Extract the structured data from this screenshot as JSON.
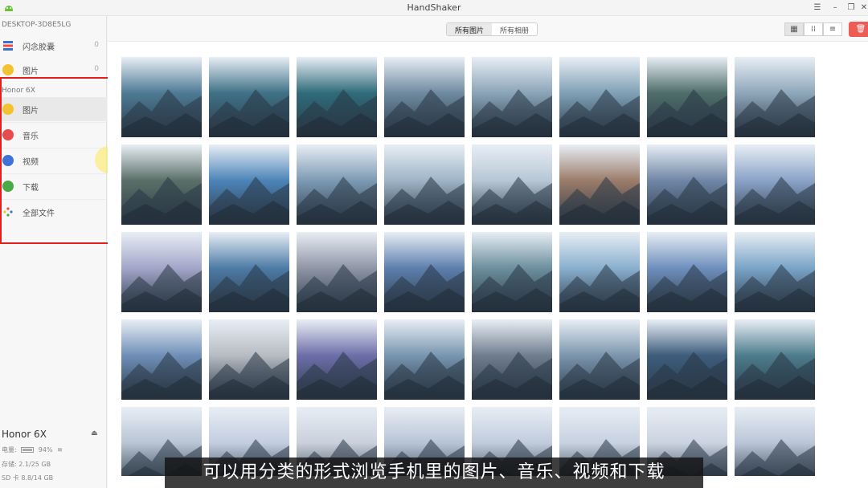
{
  "window": {
    "title": "HandShaker"
  },
  "sidebar": {
    "computer_name": "DESKTOP-3D8E5LG",
    "computer_items": [
      {
        "label": "闪念胶囊",
        "count": "0",
        "color": "#3b6fd0",
        "icon": "capsule-icon"
      },
      {
        "label": "图片",
        "count": "0",
        "color": "#f2c230",
        "icon": "photo-icon"
      }
    ],
    "device_header": "Honor 6X",
    "device_items": [
      {
        "label": "图片",
        "color": "#f2c230",
        "icon": "photo-icon"
      },
      {
        "label": "音乐",
        "color": "#e84b4b",
        "icon": "music-icon"
      },
      {
        "label": "视频",
        "color": "#3e72d8",
        "icon": "video-icon"
      },
      {
        "label": "下载",
        "color": "#49a947",
        "icon": "download-icon"
      },
      {
        "label": "全部文件",
        "color": "#e8a23a",
        "icon": "all-files-icon"
      }
    ],
    "device_status": {
      "name": "Honor 6X",
      "battery_label": "电量:",
      "battery_value": "94%",
      "battery_level": 0.94,
      "storage_label": "存储:",
      "storage_value": "2.1/25 GB",
      "sd_label": "SD 卡",
      "sd_value": "8.8/14 GB"
    }
  },
  "toolbar": {
    "tabs": [
      "所有图片",
      "所有相册"
    ],
    "active_tab": 0,
    "view_modes": [
      "grid-large-icon",
      "grid-small-icon",
      "list-icon"
    ],
    "delete_icon": "trash-icon"
  },
  "photos": {
    "rows": [
      [
        "#4d7a94",
        "#3f7186",
        "#2f6b7a",
        "#6e8aa0",
        "#8aa4b8",
        "#7fa0b6",
        "#4e6d6a",
        "#8ea7ba"
      ],
      [
        "#5a6f68",
        "#4c84b8",
        "#7c9ab4",
        "#9eb4c6",
        "#b7c7d6",
        "#9b7c6a",
        "#6f86a6",
        "#8aa3c8"
      ],
      [
        "#a3a6c9",
        "#4d7ba6",
        "#8f96a6",
        "#5d7fae",
        "#6c8f9e",
        "#8ab0cf",
        "#6e8fbd",
        "#7aa4c8"
      ],
      [
        "#6f8fb7",
        "#b7bcc3",
        "#6c6ea8",
        "#7895b0",
        "#6f7d8e",
        "#7b95ad",
        "#3d5c7c",
        "#4d7c8c"
      ],
      [
        "#b9c5d5",
        "#c3cde0",
        "#c9d0dc",
        "#b7c4d6",
        "#c0cbdc",
        "#c7d1e0",
        "#cbd3e1",
        "#bac6d7"
      ]
    ]
  },
  "subtitle": "可以用分类的形式浏览手机里的图片、音乐、视频和下载"
}
